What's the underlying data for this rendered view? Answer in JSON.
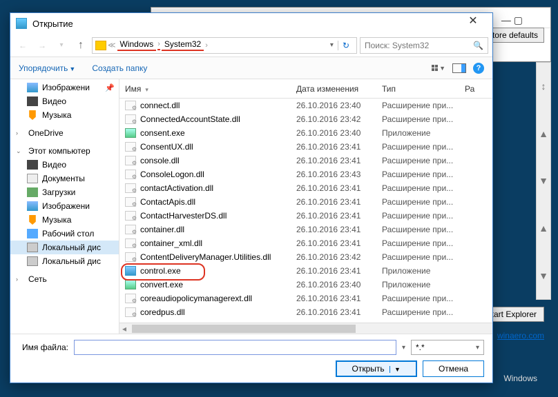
{
  "bg": {
    "restore": "Restore defaults",
    "restart": "start Explorer",
    "link": "winaero.com",
    "label": "Windows"
  },
  "dialog": {
    "title": "Открытие",
    "breadcrumb": {
      "seg1": "Windows",
      "seg2": "System32"
    },
    "search_placeholder": "Поиск: System32",
    "toolbar": {
      "organize": "Упорядочить",
      "newfolder": "Создать папку"
    },
    "columns": {
      "name": "Имя",
      "date": "Дата изменения",
      "type": "Тип",
      "size": "Ра"
    },
    "filter": "*.*",
    "filename_label": "Имя файла:",
    "filename_value": "",
    "open": "Открыть",
    "cancel": "Отмена"
  },
  "sidebar": {
    "items1": [
      {
        "label": "Изображени",
        "icon": "ic-img",
        "pin": true
      },
      {
        "label": "Видео",
        "icon": "ic-vid"
      },
      {
        "label": "Музыка",
        "icon": "ic-mus"
      }
    ],
    "onedrive": "OneDrive",
    "thispc": "Этот компьютер",
    "items2": [
      {
        "label": "Видео",
        "icon": "ic-vid"
      },
      {
        "label": "Документы",
        "icon": "ic-doc"
      },
      {
        "label": "Загрузки",
        "icon": "ic-dl"
      },
      {
        "label": "Изображени",
        "icon": "ic-img"
      },
      {
        "label": "Музыка",
        "icon": "ic-mus"
      },
      {
        "label": "Рабочий стол",
        "icon": "ic-desk"
      },
      {
        "label": "Локальный дис",
        "icon": "ic-disk",
        "sel": true
      },
      {
        "label": "Локальный дис",
        "icon": "ic-disk"
      }
    ],
    "network": "Сеть"
  },
  "files": [
    {
      "name": "connect.dll",
      "date": "26.10.2016 23:40",
      "type": "Расширение при...",
      "icon": "fic-dll"
    },
    {
      "name": "ConnectedAccountState.dll",
      "date": "26.10.2016 23:42",
      "type": "Расширение при...",
      "icon": "fic-dll"
    },
    {
      "name": "consent.exe",
      "date": "26.10.2016 23:40",
      "type": "Приложение",
      "icon": "fic-exe"
    },
    {
      "name": "ConsentUX.dll",
      "date": "26.10.2016 23:41",
      "type": "Расширение при...",
      "icon": "fic-dll"
    },
    {
      "name": "console.dll",
      "date": "26.10.2016 23:41",
      "type": "Расширение при...",
      "icon": "fic-dll"
    },
    {
      "name": "ConsoleLogon.dll",
      "date": "26.10.2016 23:43",
      "type": "Расширение при...",
      "icon": "fic-dll"
    },
    {
      "name": "contactActivation.dll",
      "date": "26.10.2016 23:41",
      "type": "Расширение при...",
      "icon": "fic-dll"
    },
    {
      "name": "ContactApis.dll",
      "date": "26.10.2016 23:41",
      "type": "Расширение при...",
      "icon": "fic-dll"
    },
    {
      "name": "ContactHarvesterDS.dll",
      "date": "26.10.2016 23:41",
      "type": "Расширение при...",
      "icon": "fic-dll"
    },
    {
      "name": "container.dll",
      "date": "26.10.2016 23:41",
      "type": "Расширение при...",
      "icon": "fic-dll"
    },
    {
      "name": "container_xml.dll",
      "date": "26.10.2016 23:41",
      "type": "Расширение при...",
      "icon": "fic-dll"
    },
    {
      "name": "ContentDeliveryManager.Utilities.dll",
      "date": "26.10.2016 23:42",
      "type": "Расширение при...",
      "icon": "fic-dll"
    },
    {
      "name": "control.exe",
      "date": "26.10.2016 23:41",
      "type": "Приложение",
      "icon": "fic-exe2",
      "hl": true
    },
    {
      "name": "convert.exe",
      "date": "26.10.2016 23:40",
      "type": "Приложение",
      "icon": "fic-exe"
    },
    {
      "name": "coreaudiopolicymanagerext.dll",
      "date": "26.10.2016 23:41",
      "type": "Расширение при...",
      "icon": "fic-dll"
    },
    {
      "name": "coredpus.dll",
      "date": "26.10.2016 23:41",
      "type": "Расширение при...",
      "icon": "fic-dll"
    }
  ]
}
